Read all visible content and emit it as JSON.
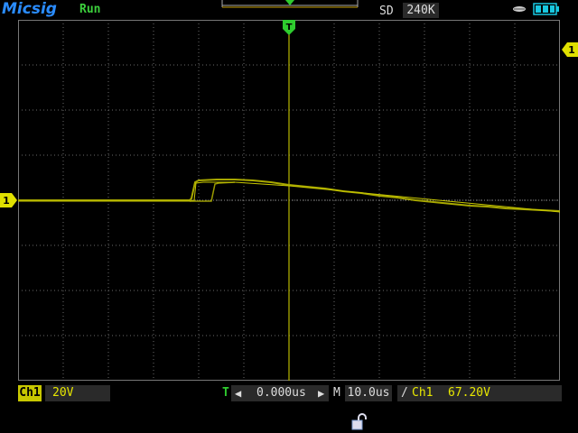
{
  "header": {
    "brand": "Micsig",
    "run_state": "Run",
    "memory_mode": "SD",
    "memory_depth": "240K"
  },
  "footer": {
    "channel_label": "Ch1",
    "channel_scale": "20V",
    "trigger_icon_label": "T",
    "horizontal_position": "0.000us",
    "timebase_label": "M",
    "timebase": "10.0us",
    "trigger_slope": "/",
    "trigger_source": "Ch1",
    "trigger_level": "67.20V"
  },
  "markers": {
    "channel_marker": "1",
    "trigger_level_marker": "1",
    "trigger_position_marker": "T"
  },
  "colors": {
    "channel1": "#c8c800",
    "trace": "#b0b000",
    "grid": "#6a6a6a",
    "trigger_green": "#2ecc2e",
    "brand_blue": "#2a8cff",
    "battery": "#18c8e0"
  },
  "icons": {
    "battery": "battery-icon",
    "usb": "usb-icon",
    "lock": "lock-icon"
  }
}
